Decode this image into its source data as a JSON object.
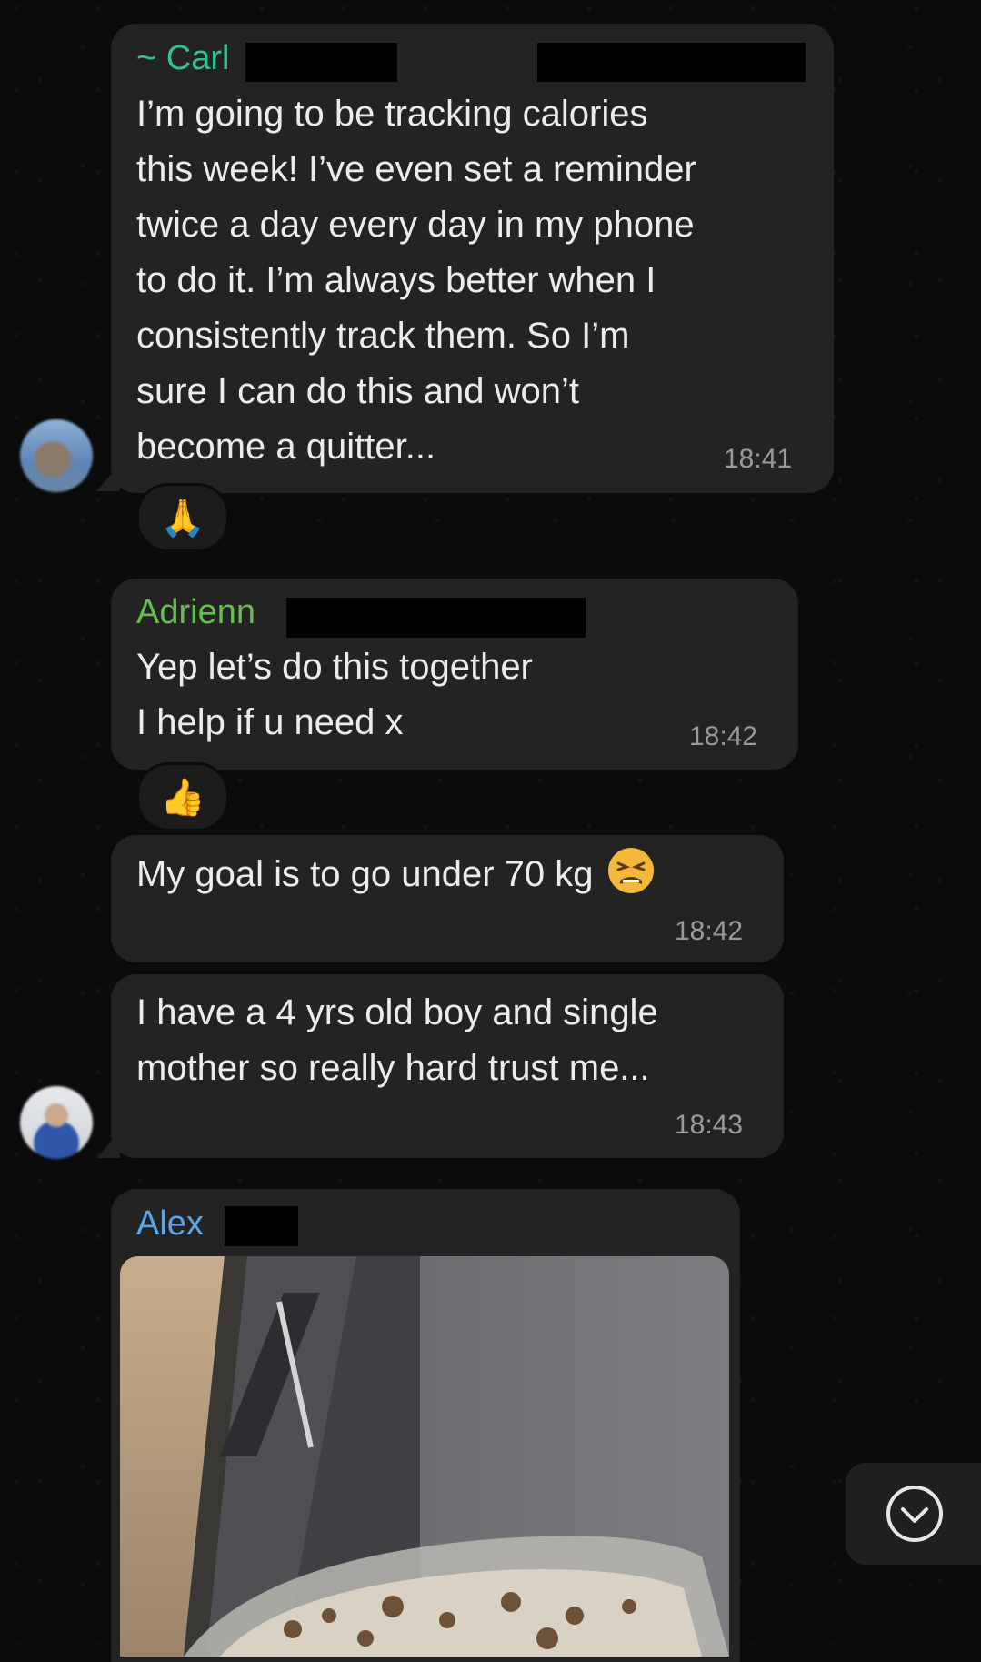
{
  "colors": {
    "bubble_bg": "#232323",
    "time_color": "#9a9a9a",
    "carl_name_color": "#33c28c",
    "adrienn_name_color": "#63c04c",
    "alex_name_color": "#5aa6e8"
  },
  "messages": [
    {
      "sender": "~ Carl",
      "text": "I’m going to be tracking calories\nthis week!  I’ve even set a reminder\ntwice a day every day in my phone\nto do it.  I’m always better when I\nconsistently track them.  So I’m\nsure I can do this and won’t\nbecome a quitter...",
      "time": "18:41",
      "reaction": "🙏",
      "reaction_icon": "folded-hands-icon"
    },
    {
      "sender": "Adrienn",
      "text": "Yep let’s do this together\nI help if u need x",
      "time": "18:42",
      "reaction": "👍",
      "reaction_icon": "thumbs-up-icon"
    },
    {
      "text": "My goal is to go under 70 kg",
      "emoji_icon": "tired-face-icon",
      "time": "18:42"
    },
    {
      "text": "I have a 4 yrs old boy and single\nmother so really hard trust me...",
      "time": "18:43"
    },
    {
      "sender": "Alex",
      "media": "photo",
      "media_icon": "food-container-photo"
    }
  ],
  "scroll_button": {
    "icon": "chevron-down-circle-icon"
  }
}
